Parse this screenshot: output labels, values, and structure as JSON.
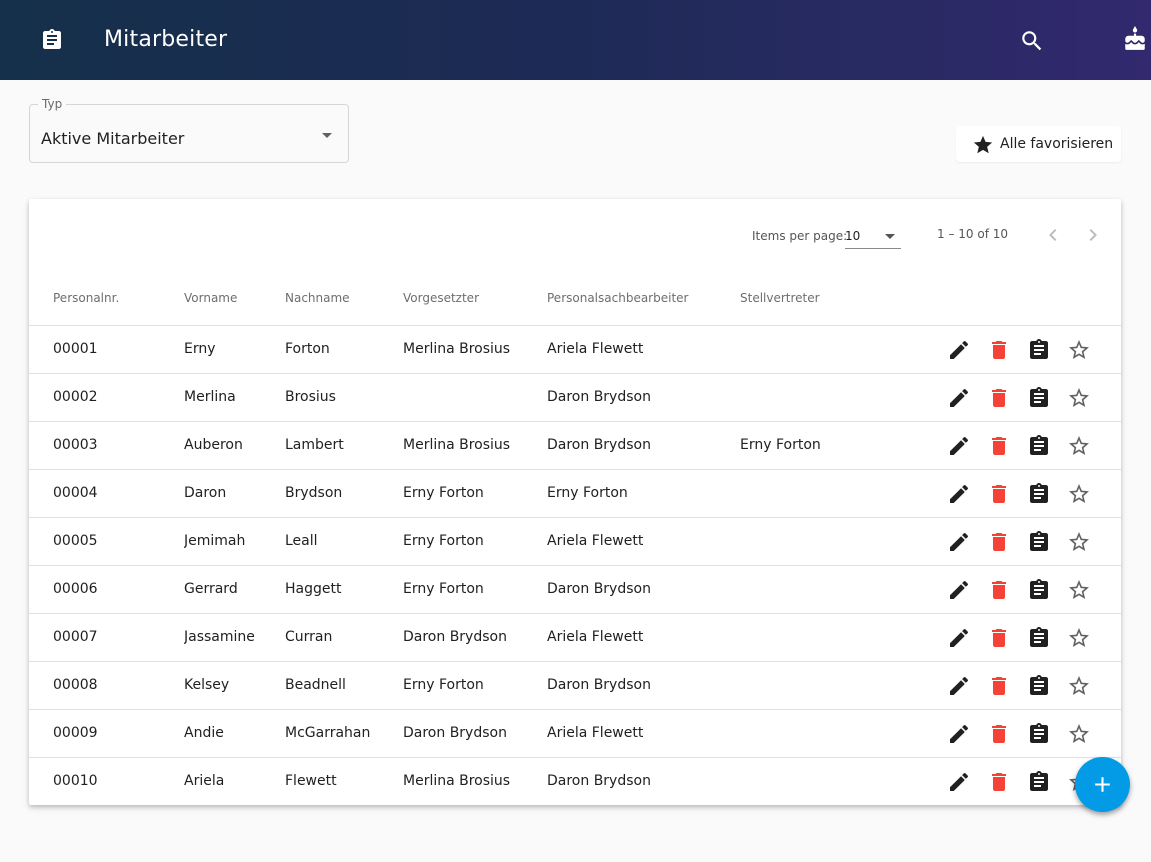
{
  "header": {
    "title": "Mitarbeiter",
    "logo_icon": "clipboard-icon",
    "search_icon": "search-icon",
    "cake_icon": "cake-icon",
    "gradient": [
      "#15304a",
      "#32296e"
    ]
  },
  "filter": {
    "legend": "Typ",
    "selected": "Aktive Mitarbeiter"
  },
  "favorite_all": {
    "label": "Alle favorisieren",
    "icon": "star-icon"
  },
  "paginator": {
    "items_per_page_label": "Items per page:",
    "items_per_page_value": "10",
    "range_label": "1 – 10 of 10"
  },
  "table": {
    "columns": [
      "Personalnr.",
      "Vorname",
      "Nachname",
      "Vorgesetzter",
      "Personalsachbearbeiter",
      "Stellvertreter"
    ],
    "rows": [
      {
        "nr": "00001",
        "vorname": "Erny",
        "nachname": "Forton",
        "vorgesetzter": "Merlina Brosius",
        "psb": "Ariela Flewett",
        "stellvertreter": ""
      },
      {
        "nr": "00002",
        "vorname": "Merlina",
        "nachname": "Brosius",
        "vorgesetzter": "",
        "psb": "Daron Brydson",
        "stellvertreter": ""
      },
      {
        "nr": "00003",
        "vorname": "Auberon",
        "nachname": "Lambert",
        "vorgesetzter": "Merlina Brosius",
        "psb": "Daron Brydson",
        "stellvertreter": "Erny Forton"
      },
      {
        "nr": "00004",
        "vorname": "Daron",
        "nachname": "Brydson",
        "vorgesetzter": "Erny Forton",
        "psb": "Erny Forton",
        "stellvertreter": ""
      },
      {
        "nr": "00005",
        "vorname": "Jemimah",
        "nachname": "Leall",
        "vorgesetzter": "Erny Forton",
        "psb": "Ariela Flewett",
        "stellvertreter": ""
      },
      {
        "nr": "00006",
        "vorname": "Gerrard",
        "nachname": "Haggett",
        "vorgesetzter": "Erny Forton",
        "psb": "Daron Brydson",
        "stellvertreter": ""
      },
      {
        "nr": "00007",
        "vorname": "Jassamine",
        "nachname": "Curran",
        "vorgesetzter": "Daron Brydson",
        "psb": "Ariela Flewett",
        "stellvertreter": ""
      },
      {
        "nr": "00008",
        "vorname": "Kelsey",
        "nachname": "Beadnell",
        "vorgesetzter": "Erny Forton",
        "psb": "Daron Brydson",
        "stellvertreter": ""
      },
      {
        "nr": "00009",
        "vorname": "Andie",
        "nachname": "McGarrahan",
        "vorgesetzter": "Daron Brydson",
        "psb": "Ariela Flewett",
        "stellvertreter": ""
      },
      {
        "nr": "00010",
        "vorname": "Ariela",
        "nachname": "Flewett",
        "vorgesetzter": "Merlina Brosius",
        "psb": "Daron Brydson",
        "stellvertreter": ""
      }
    ],
    "row_actions": [
      "edit-icon",
      "delete-icon",
      "clipboard-icon",
      "star-outline-icon"
    ],
    "colors": {
      "delete": "#f44336",
      "icon": "#212121",
      "star_outline": "#616161"
    }
  },
  "fab": {
    "icon": "plus-icon",
    "color": "#039be5"
  }
}
